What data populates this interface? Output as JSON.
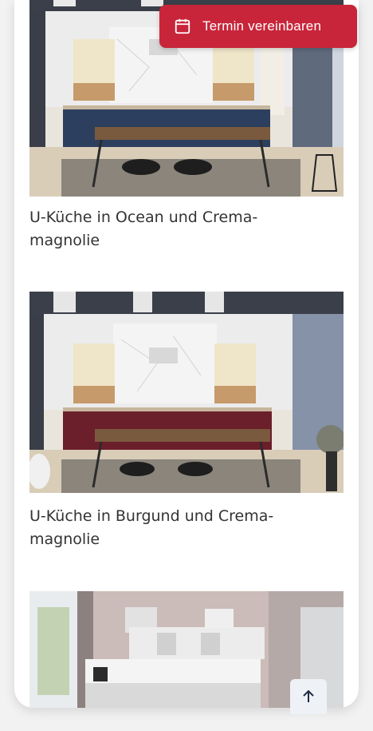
{
  "cta": {
    "label": "Termin vereinbaren",
    "icon": "calendar-icon",
    "color": "#c8253a"
  },
  "items": [
    {
      "caption": "U-Küche in Ocean und Crema-magnolie",
      "accent": "#2d3f5e"
    },
    {
      "caption": "U-Küche in Burgund und Crema-magnolie",
      "accent": "#6b1f2a"
    },
    {
      "caption": ""
    }
  ],
  "back_to_top": {
    "icon": "arrow-up-icon"
  }
}
